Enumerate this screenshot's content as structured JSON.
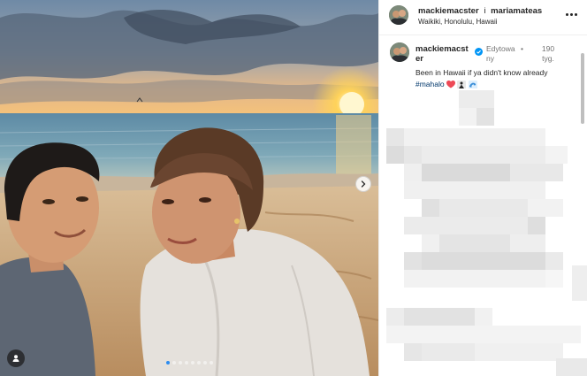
{
  "post": {
    "header": {
      "username": "mackiemacster",
      "separator": "i",
      "collaborator": "mariamateas",
      "location": "Waikiki, Honolulu, Hawaii"
    },
    "caption": {
      "username": "mackiemacster",
      "edited_label": "Edytowany",
      "bullet": "•",
      "age": "190 tyg.",
      "text": "Been in Hawaii if ya didn't know already",
      "hashtag": "#mahalo"
    },
    "carousel": {
      "slide_count": 8,
      "active_index": 0
    },
    "colors": {
      "verified": "#0095f6",
      "hashtag": "#00376b",
      "active_dot": "#2d8cf0"
    },
    "icons": [
      "chevron-right-icon",
      "user-tag-icon",
      "more-options-icon",
      "verified-badge-icon",
      "heart-emoji",
      "wave-emoji"
    ]
  }
}
